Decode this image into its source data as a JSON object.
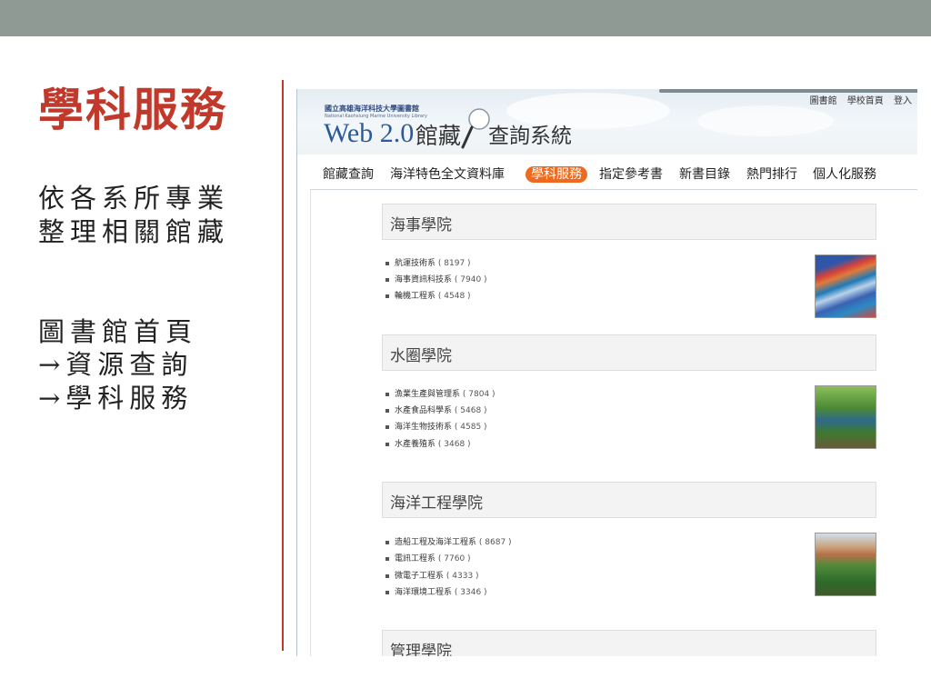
{
  "slide": {
    "title": "學科服務",
    "body_lines": [
      "依各系所專業",
      "整理相關館藏"
    ],
    "path_lines": [
      "圖書館首頁",
      "→資源查詢",
      "→學科服務"
    ]
  },
  "site": {
    "library_name_zh": "國立高雄海洋科技大學圖書館",
    "library_name_en": "National Kaohsiung Marine University Library",
    "logo_web": "Web 2.0",
    "logo_zh_1": "館藏",
    "logo_zh_2": "查詢系統",
    "top_links": [
      "圖書館",
      "學校首頁",
      "登入"
    ]
  },
  "nav": {
    "items": [
      "館藏查詢",
      "海洋特色全文資料庫",
      "學科服務",
      "指定參考書",
      "新書目錄",
      "熱門排行",
      "個人化服務"
    ],
    "active_index": 2
  },
  "colleges": [
    {
      "name": "海事學院",
      "departments": [
        {
          "name": "航運技術系",
          "count": "( 8197 )"
        },
        {
          "name": "海事資訊科技系",
          "count": "( 7940 )"
        },
        {
          "name": "輪機工程系",
          "count": "( 4548 )"
        }
      ]
    },
    {
      "name": "水圈學院",
      "departments": [
        {
          "name": "漁業生產與管理系",
          "count": "( 7804 )"
        },
        {
          "name": "水產食品科學系",
          "count": "( 5468 )"
        },
        {
          "name": "海洋生物技術系",
          "count": "( 4585 )"
        },
        {
          "name": "水產養殖系",
          "count": "( 3468 )"
        }
      ]
    },
    {
      "name": "海洋工程學院",
      "departments": [
        {
          "name": "造船工程及海洋工程系",
          "count": "( 8687 )"
        },
        {
          "name": "電訊工程系",
          "count": "( 7760 )"
        },
        {
          "name": "微電子工程系",
          "count": "( 4333 )"
        },
        {
          "name": "海洋環境工程系",
          "count": "( 3346 )"
        }
      ]
    },
    {
      "name": "管理學院",
      "departments": []
    }
  ],
  "colors": {
    "accent_red": "#c0392b",
    "nav_active": "#ee6a1f",
    "top_bar": "#8f9a94"
  }
}
